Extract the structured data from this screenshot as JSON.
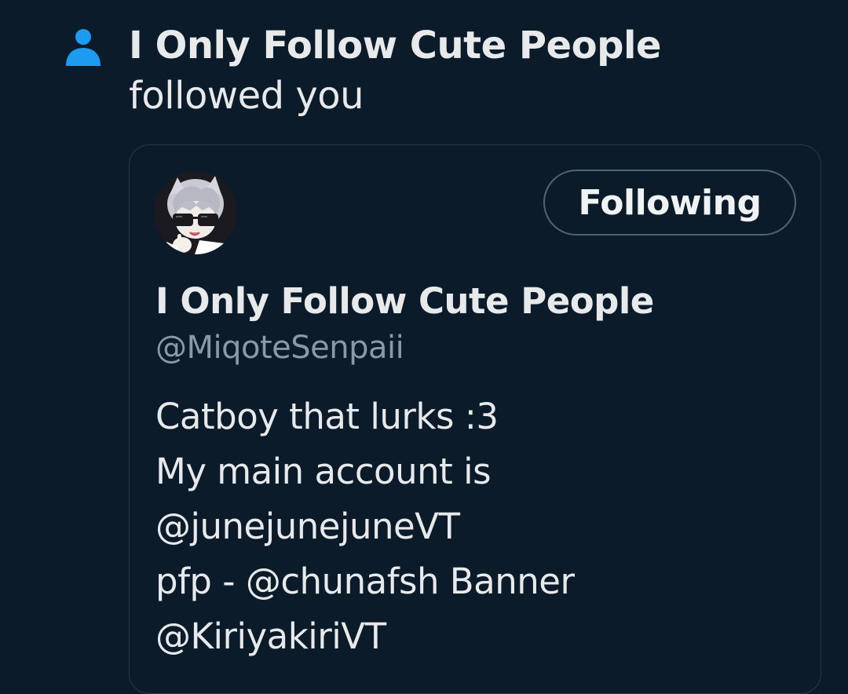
{
  "notification": {
    "icon": "person-icon",
    "actor_name": "I Only Follow Cute People",
    "action_text": " followed you"
  },
  "profile_card": {
    "avatar": "avatar",
    "follow_button_label": "Following",
    "display_name": "I Only Follow Cute People",
    "handle": "@MiqoteSenpaii",
    "bio_lines": [
      "Catboy that lurks :3",
      "My main account is",
      "@junejunejuneVT",
      "pfp - @chunafsh Banner",
      "@KiriyakiriVT"
    ]
  },
  "colors": {
    "background": "#0c1b29",
    "icon_blue": "#1d9bf0",
    "text_primary": "#e7e9ea",
    "text_secondary": "#8b98a5",
    "border": "#2a3a49"
  }
}
